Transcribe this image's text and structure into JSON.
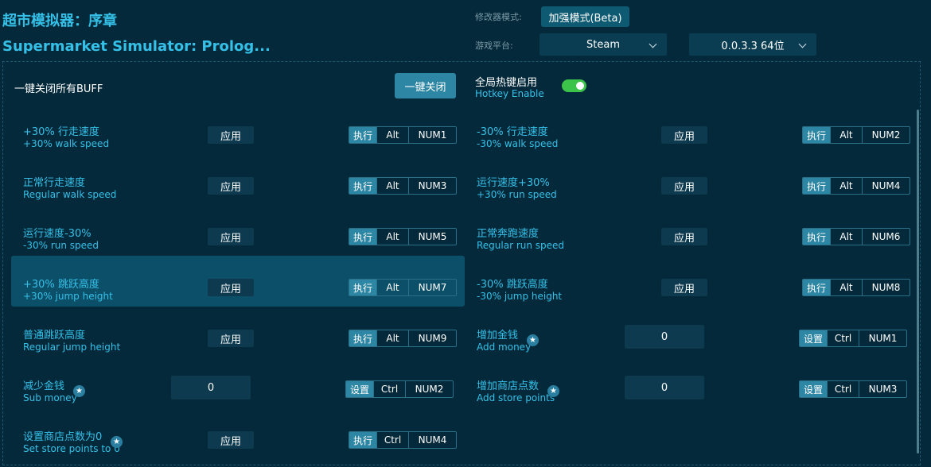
{
  "header": {
    "title_cn": "超市模拟器：序章",
    "title_en": "Supermarket Simulator: Prolog...",
    "mode_label": "修改器模式:",
    "mode_value": "加强模式(Beta)",
    "platform_label": "游戏平台:",
    "platform_value": "Steam",
    "version_value": "0.0.3.3 64位"
  },
  "top": {
    "close_all_label": "一键关闭所有BUFF",
    "close_all_button": "一键关闭",
    "hotkey_cn": "全局热键启用",
    "hotkey_en": "Hotkey Enable",
    "hotkey_enabled": true
  },
  "left": [
    {
      "cn": "+30% 行走速度",
      "en": "+30% walk speed",
      "control": "应用",
      "action": "执行",
      "mod": "Alt",
      "key": "NUM1",
      "highlight": false
    },
    {
      "cn": "正常行走速度",
      "en": "Regular walk speed",
      "control": "应用",
      "action": "执行",
      "mod": "Alt",
      "key": "NUM3",
      "highlight": false
    },
    {
      "cn": "运行速度-30%",
      "en": "-30% run speed",
      "control": "应用",
      "action": "执行",
      "mod": "Alt",
      "key": "NUM5",
      "highlight": false
    },
    {
      "cn": "+30% 跳跃高度",
      "en": "+30% jump height",
      "control": "应用",
      "action": "执行",
      "mod": "Alt",
      "key": "NUM7",
      "highlight": true
    },
    {
      "cn": "普通跳跃高度",
      "en": "Regular jump height",
      "control": "应用",
      "action": "执行",
      "mod": "Alt",
      "key": "NUM9",
      "highlight": false
    },
    {
      "cn": "减少金钱",
      "en": "Sub money",
      "star": true,
      "input": "0",
      "action": "设置",
      "mod": "Ctrl",
      "key": "NUM2",
      "highlight": false
    },
    {
      "cn": "设置商店点数为0",
      "en": "Set store points to 0",
      "star": true,
      "control": "应用",
      "action": "执行",
      "mod": "Ctrl",
      "key": "NUM4",
      "highlight": false
    }
  ],
  "right": [
    {
      "cn": "-30% 行走速度",
      "en": "-30% walk speed",
      "control": "应用",
      "action": "执行",
      "mod": "Alt",
      "key": "NUM2"
    },
    {
      "cn": "运行速度+30%",
      "en": "+30% run speed",
      "control": "应用",
      "action": "执行",
      "mod": "Alt",
      "key": "NUM4"
    },
    {
      "cn": "正常奔跑速度",
      "en": "Regular run speed",
      "control": "应用",
      "action": "执行",
      "mod": "Alt",
      "key": "NUM6"
    },
    {
      "cn": "-30% 跳跃高度",
      "en": "-30% jump height",
      "control": "应用",
      "action": "执行",
      "mod": "Alt",
      "key": "NUM8"
    },
    {
      "cn": "增加金钱",
      "en": "Add money",
      "star": true,
      "input": "0",
      "action": "设置",
      "mod": "Ctrl",
      "key": "NUM1"
    },
    {
      "cn": "增加商店点数",
      "en": "Add store points",
      "star": true,
      "input": "0",
      "action": "设置",
      "mod": "Ctrl",
      "key": "NUM3"
    }
  ],
  "icons": {
    "star": "★",
    "chevron": "chevron-down-icon"
  }
}
